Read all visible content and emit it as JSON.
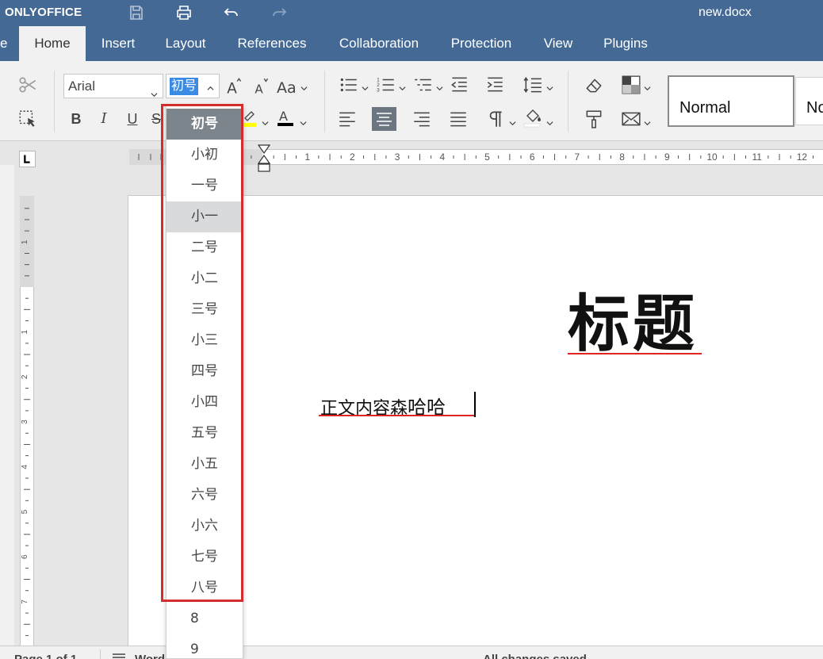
{
  "app": {
    "name": "ONLYOFFICE",
    "document_title": "new.docx"
  },
  "title_icons": [
    "save-icon",
    "print-icon",
    "undo-icon",
    "redo-icon"
  ],
  "tabs": [
    {
      "label": "e",
      "active": false
    },
    {
      "label": "Home",
      "active": true
    },
    {
      "label": "Insert",
      "active": false
    },
    {
      "label": "Layout",
      "active": false
    },
    {
      "label": "References",
      "active": false
    },
    {
      "label": "Collaboration",
      "active": false
    },
    {
      "label": "Protection",
      "active": false
    },
    {
      "label": "View",
      "active": false
    },
    {
      "label": "Plugins",
      "active": false
    }
  ],
  "toolbar": {
    "font_name": "Arial",
    "font_size": "初号",
    "format_labels": {
      "bold": "B",
      "italic": "I",
      "underline": "U",
      "strike": "S"
    },
    "styles": [
      "Normal",
      "No"
    ]
  },
  "ruler": {
    "h_labels": [
      "1",
      "2",
      "3",
      "4",
      "5",
      "6",
      "7",
      "8",
      "9",
      "10",
      "11",
      "12"
    ],
    "v_labels": [
      "1",
      "1",
      "2",
      "3",
      "4",
      "5",
      "6",
      "7"
    ]
  },
  "document": {
    "heading": "标题",
    "body_normal": "正文内容森",
    "body_bold": "哈哈"
  },
  "font_size_dropdown": {
    "selected": "初号",
    "hovered": "小一",
    "options": [
      "初号",
      "小初",
      "一号",
      "小一",
      "二号",
      "小二",
      "三号",
      "小三",
      "四号",
      "小四",
      "五号",
      "小五",
      "六号",
      "小六",
      "七号",
      "八号",
      "8",
      "9"
    ]
  },
  "statusbar": {
    "page": "Page 1 of 1",
    "word_count": "Word",
    "save_status": "All changes saved"
  },
  "colors": {
    "header": "#446995",
    "highlight_border": "#d42d2d",
    "selection": "#3b8ae4",
    "spellcheck": "#e02424"
  }
}
